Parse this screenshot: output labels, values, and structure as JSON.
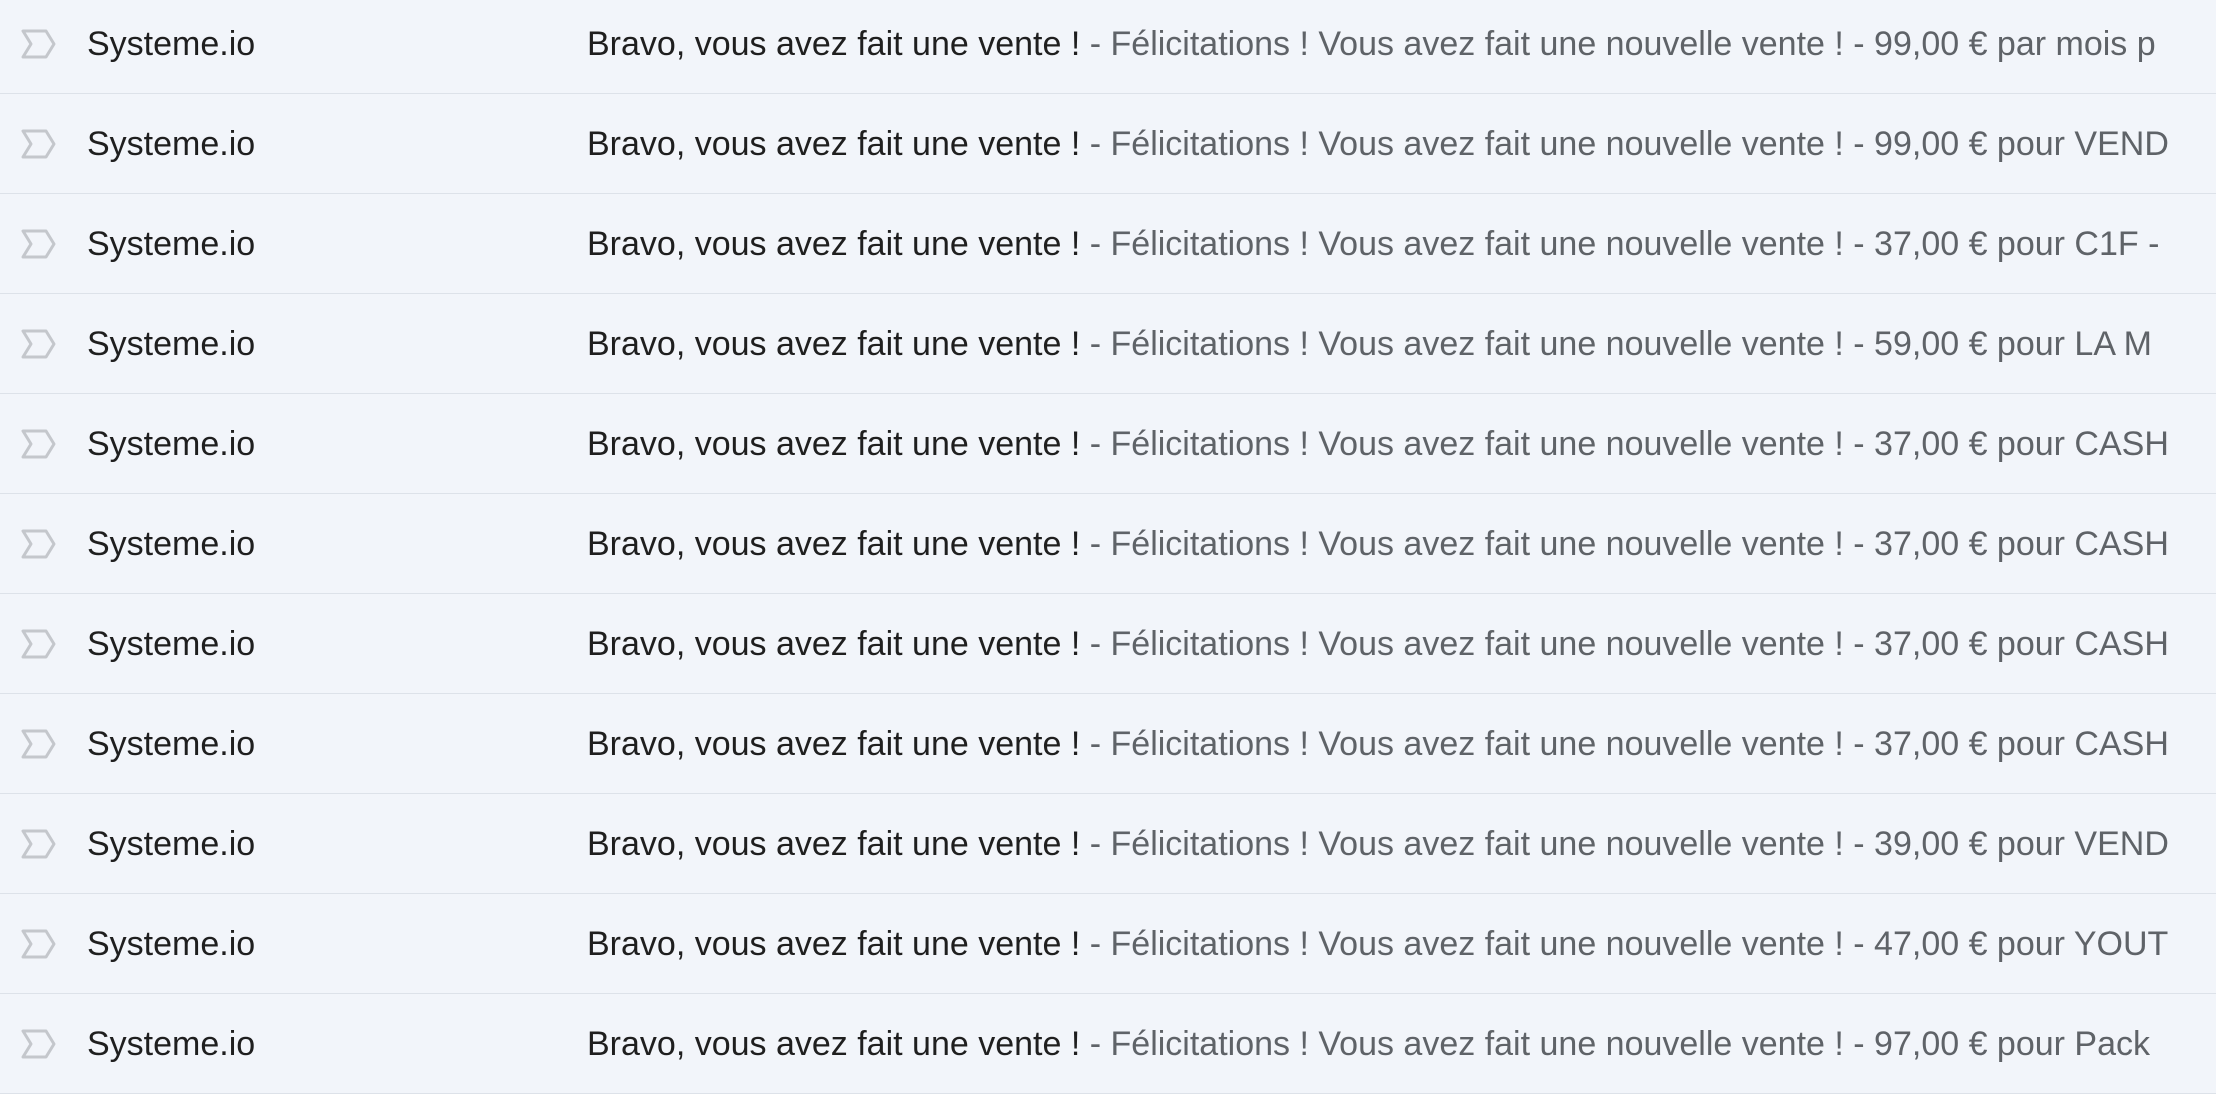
{
  "inbox": {
    "rows": [
      {
        "sender": "Systeme.io",
        "subject": "Bravo, vous avez fait une vente !",
        "snippet": " - Félicitations ! Vous avez fait une nouvelle vente ! - 99,00 € par mois p"
      },
      {
        "sender": "Systeme.io",
        "subject": "Bravo, vous avez fait une vente !",
        "snippet": " - Félicitations ! Vous avez fait une nouvelle vente ! - 99,00 € pour VEND"
      },
      {
        "sender": "Systeme.io",
        "subject": "Bravo, vous avez fait une vente !",
        "snippet": " - Félicitations ! Vous avez fait une nouvelle vente ! - 37,00 € pour C1F -"
      },
      {
        "sender": "Systeme.io",
        "subject": "Bravo, vous avez fait une vente !",
        "snippet": " - Félicitations ! Vous avez fait une nouvelle vente ! - 59,00 € pour LA M"
      },
      {
        "sender": "Systeme.io",
        "subject": "Bravo, vous avez fait une vente !",
        "snippet": " - Félicitations ! Vous avez fait une nouvelle vente ! - 37,00 € pour CASH"
      },
      {
        "sender": "Systeme.io",
        "subject": "Bravo, vous avez fait une vente !",
        "snippet": " - Félicitations ! Vous avez fait une nouvelle vente ! - 37,00 € pour CASH"
      },
      {
        "sender": "Systeme.io",
        "subject": "Bravo, vous avez fait une vente !",
        "snippet": " - Félicitations ! Vous avez fait une nouvelle vente ! - 37,00 € pour CASH"
      },
      {
        "sender": "Systeme.io",
        "subject": "Bravo, vous avez fait une vente !",
        "snippet": " - Félicitations ! Vous avez fait une nouvelle vente ! - 37,00 € pour CASH"
      },
      {
        "sender": "Systeme.io",
        "subject": "Bravo, vous avez fait une vente !",
        "snippet": " - Félicitations ! Vous avez fait une nouvelle vente ! - 39,00 € pour VEND"
      },
      {
        "sender": "Systeme.io",
        "subject": "Bravo, vous avez fait une vente !",
        "snippet": " - Félicitations ! Vous avez fait une nouvelle vente ! - 47,00 € pour YOUT"
      },
      {
        "sender": "Systeme.io",
        "subject": "Bravo, vous avez fait une vente !",
        "snippet": " - Félicitations ! Vous avez fait une nouvelle vente ! - 97,00 € pour Pack"
      }
    ],
    "importance_icon": "importance-marker-icon"
  }
}
